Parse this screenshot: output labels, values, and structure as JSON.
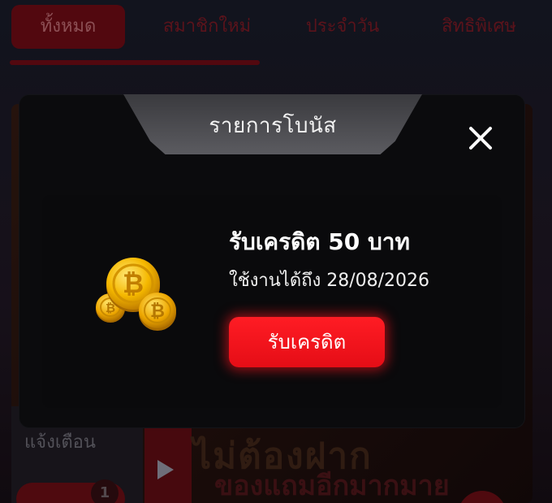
{
  "tabs": [
    {
      "label": "ทั้งหมด",
      "active": true
    },
    {
      "label": "สมาชิกใหม่",
      "active": false
    },
    {
      "label": "ประจำวัน",
      "active": false
    },
    {
      "label": "สิทธิพิเศษ",
      "active": false
    }
  ],
  "background": {
    "notification_label": "แจ้งเตือน",
    "notification_count": "1",
    "promo_line_1": "ไม่ต้องฝาก",
    "promo_line_2": "ของแถมอีกมากมาย"
  },
  "modal": {
    "title": "รายการโบนัส",
    "reward": {
      "title": "รับเครดิต 50 บาท",
      "expiry": "ใช้งานได้ถึง 28/08/2026",
      "claim_label": "รับเครดิต",
      "icon": "bitcoin-coins-icon"
    },
    "close_icon": "close-icon"
  },
  "colors": {
    "accent": "#e50d16",
    "modal_bg": "#0b0b0d",
    "header_bg": "#5b5b60"
  }
}
